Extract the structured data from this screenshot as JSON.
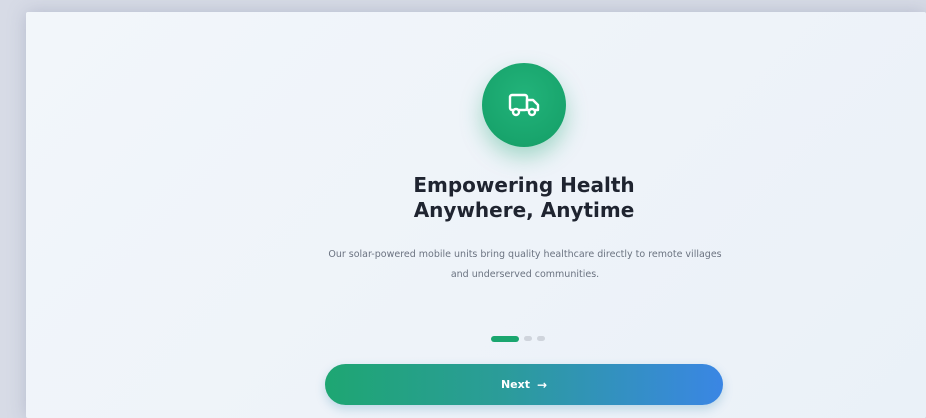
{
  "onboarding": {
    "icon": "truck-icon",
    "title_line1": "Empowering Health",
    "title_line2": "Anywhere, Anytime",
    "description": "Our solar-powered mobile units bring quality healthcare directly to remote villages and underserved communities.",
    "pagination": {
      "total": 3,
      "current": 1
    },
    "next_label": "Next",
    "next_icon": "arrow-right-icon"
  },
  "colors": {
    "primary_green": "#1aa66f",
    "gradient_end_blue": "#3a86e4",
    "title_text": "#1f2430",
    "body_text": "#6b7381",
    "inactive_dot": "#cfd4dc"
  }
}
